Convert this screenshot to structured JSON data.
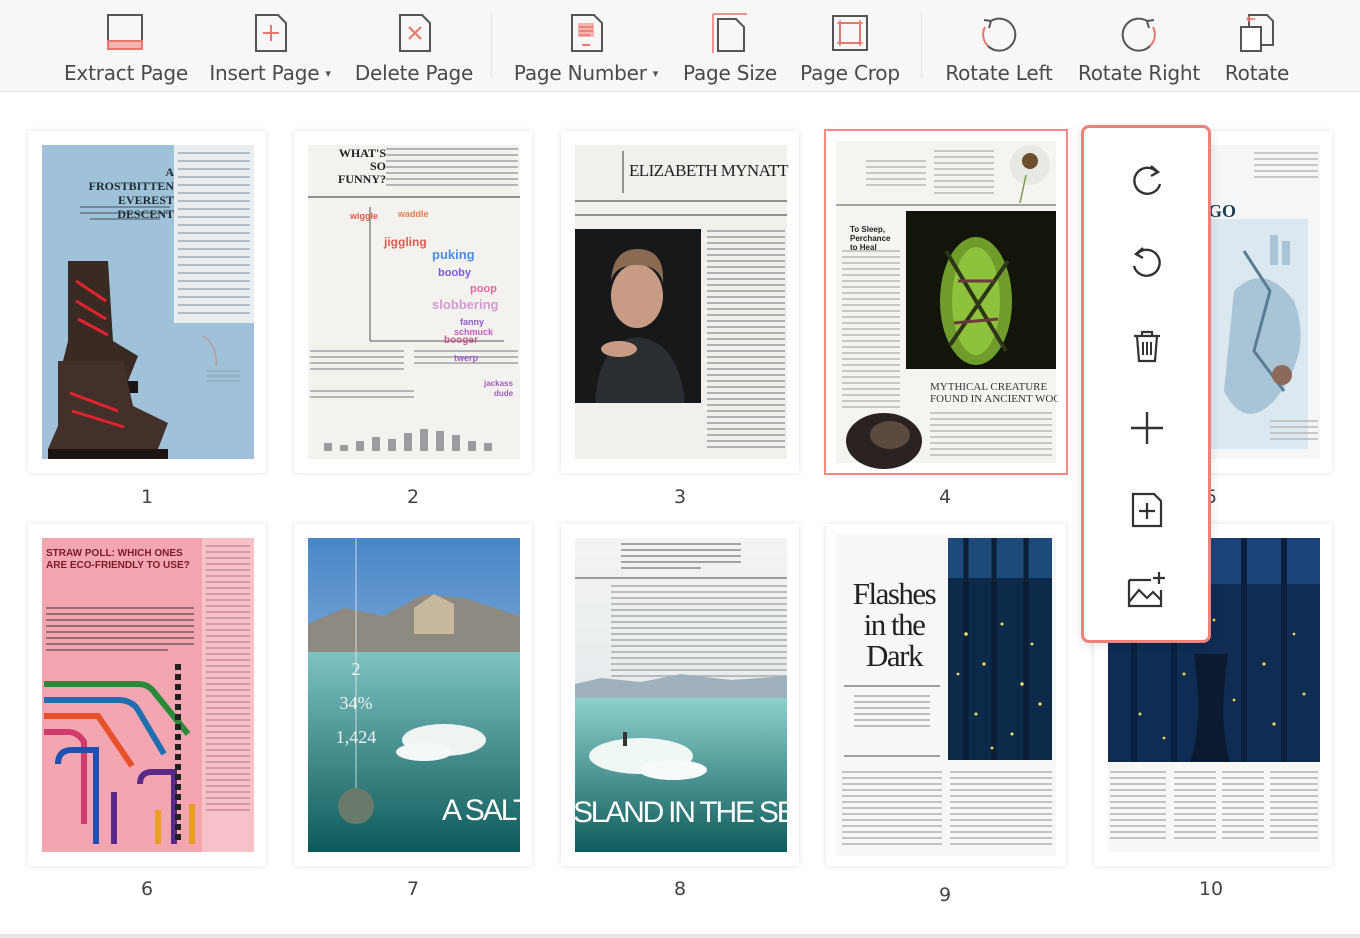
{
  "toolbar": {
    "items": [
      {
        "label": "Extract Page"
      },
      {
        "label": "Insert Page",
        "caret": "▾"
      },
      {
        "label": "Delete Page"
      },
      {
        "label": "Page Number",
        "caret": "▾"
      },
      {
        "label": "Page Size"
      },
      {
        "label": "Page Crop"
      },
      {
        "label": "Rotate Left"
      },
      {
        "label": "Rotate Right"
      },
      {
        "label": "Rotate"
      }
    ],
    "icon_color": "#e8776f"
  },
  "pages": [
    {
      "number": "1",
      "headline": [
        "A FROSTBITTEN",
        "EVEREST DESCENT"
      ]
    },
    {
      "number": "2",
      "headline": [
        "WHAT'S",
        "SO",
        "FUNNY?"
      ],
      "words": [
        "wiggle",
        "waddle",
        "jiggling",
        "puking",
        "booby",
        "poop",
        "slobbering",
        "fanny",
        "schmuck",
        "booger",
        "twerp",
        "jackass",
        "dude"
      ]
    },
    {
      "number": "3",
      "headline": [
        "ELIZABETH MYNATT"
      ]
    },
    {
      "number": "4",
      "headline": [
        "MYTHICAL CREATURE",
        "FOUND IN ANCIENT WOOD"
      ],
      "side": [
        "To Sleep,",
        "Perchance",
        "to Heal"
      ]
    },
    {
      "number": "5",
      "headline": [
        "GO"
      ]
    },
    {
      "number": "6",
      "headline": [
        "STRAW POLL: WHICH ONES",
        "ARE ECO-FRIENDLY TO USE?"
      ]
    },
    {
      "number": "7",
      "stats": [
        "2",
        "34%",
        "1,424"
      ],
      "headline": [
        "A SALTY"
      ]
    },
    {
      "number": "8",
      "headline": [
        "SLAND IN THE SEA"
      ]
    },
    {
      "number": "9",
      "headline": [
        "Flashes",
        "in the",
        "Dark"
      ]
    },
    {
      "number": "10"
    }
  ],
  "selected_page": "4",
  "context_menu": {
    "items": [
      "rotate-right",
      "rotate-left",
      "delete",
      "insert-blank",
      "insert-page",
      "insert-image"
    ],
    "border_color": "#f0807a"
  }
}
